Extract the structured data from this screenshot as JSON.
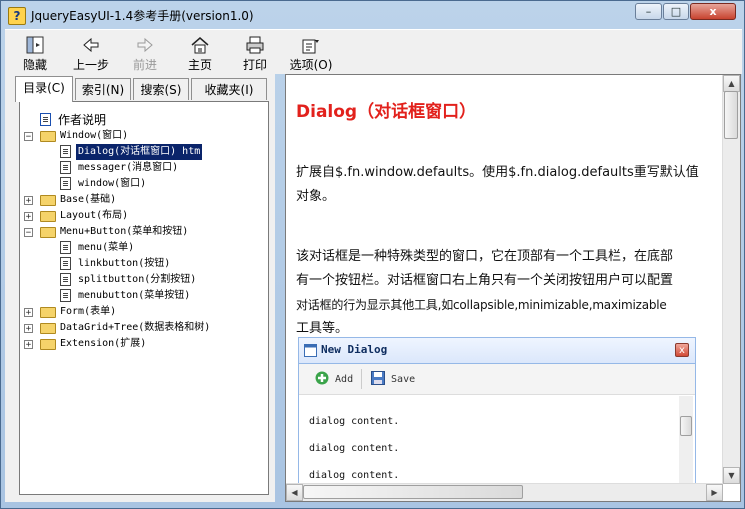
{
  "window": {
    "title": "JqueryEasyUI-1.4参考手册(version1.0)",
    "controls": {
      "minimize": "–",
      "maximize": "□",
      "close": "x"
    }
  },
  "toolbar": {
    "items": [
      {
        "label": "隐藏",
        "icon": "hide-pane-icon",
        "enabled": true
      },
      {
        "label": "上一步",
        "icon": "back-arrow-icon",
        "enabled": true
      },
      {
        "label": "前进",
        "icon": "forward-arrow-icon",
        "enabled": false
      },
      {
        "label": "主页",
        "icon": "home-icon",
        "enabled": true
      },
      {
        "label": "打印",
        "icon": "printer-icon",
        "enabled": true
      },
      {
        "label": "选项(O)",
        "icon": "options-icon",
        "enabled": true
      }
    ]
  },
  "tabs": [
    {
      "label": "目录(C)",
      "active": true
    },
    {
      "label": "索引(N)",
      "active": false
    },
    {
      "label": "搜索(S)",
      "active": false
    },
    {
      "label": "收藏夹(I)",
      "active": false
    }
  ],
  "tree": {
    "author": "作者说明",
    "window": {
      "label": "Window(窗口)",
      "children": [
        "Dialog(对话框窗口) htm",
        "messager(消息窗口)",
        "window(窗口)"
      ]
    },
    "base": "Base(基础)",
    "layout": "Layout(布局)",
    "menubutton": {
      "label": "Menu+Button(菜单和按钮)",
      "children": [
        "menu(菜单)",
        "linkbutton(按钮)",
        "splitbutton(分割按钮)",
        "menubutton(菜单按钮)"
      ]
    },
    "form": "Form(表单)",
    "datagrid": "DataGrid+Tree(数据表格和树)",
    "extension": "Extension(扩展)"
  },
  "doc": {
    "title": "Dialog（对话框窗口）",
    "para1_line1": "扩展自$.fn.window.defaults。使用$.fn.dialog.defaults重写默认值",
    "para1_line2": "对象。",
    "para2_line1": "该对话框是一种特殊类型的窗口，它在顶部有一个工具栏，在底部",
    "para2_line2": "有一个按钮栏。对话框窗口右上角只有一个关闭按钮用户可以配置",
    "para2_line3": "对话框的行为显示其他工具,如collapsible,minimizable,maximizable",
    "para2_line4": "工具等。"
  },
  "dialog": {
    "title": "New Dialog",
    "add_label": "Add",
    "save_label": "Save",
    "content": [
      "dialog content.",
      "dialog content.",
      "dialog content."
    ]
  }
}
